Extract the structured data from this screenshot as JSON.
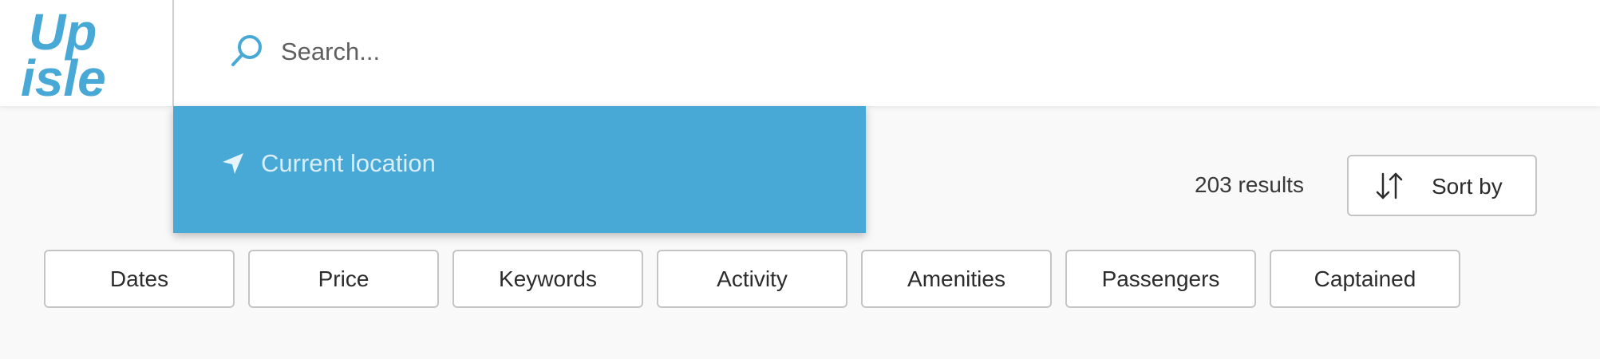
{
  "header": {
    "logo_text": "Up isle",
    "search": {
      "placeholder": "Search...",
      "value": ""
    }
  },
  "dropdown": {
    "items": [
      {
        "label": "Current location",
        "icon": "navigation-arrow-icon"
      }
    ]
  },
  "results": {
    "count_text": "203 results"
  },
  "sort": {
    "label": "Sort by",
    "icon": "sort-arrows-icon"
  },
  "filters": [
    {
      "label": "Dates"
    },
    {
      "label": "Price"
    },
    {
      "label": "Keywords"
    },
    {
      "label": "Activity"
    },
    {
      "label": "Amenities"
    },
    {
      "label": "Passengers"
    },
    {
      "label": "Captained"
    }
  ],
  "colors": {
    "brand": "#48a8d6",
    "background": "#f9f9f9",
    "header": "#ffffff",
    "border": "#c4c4c4"
  }
}
